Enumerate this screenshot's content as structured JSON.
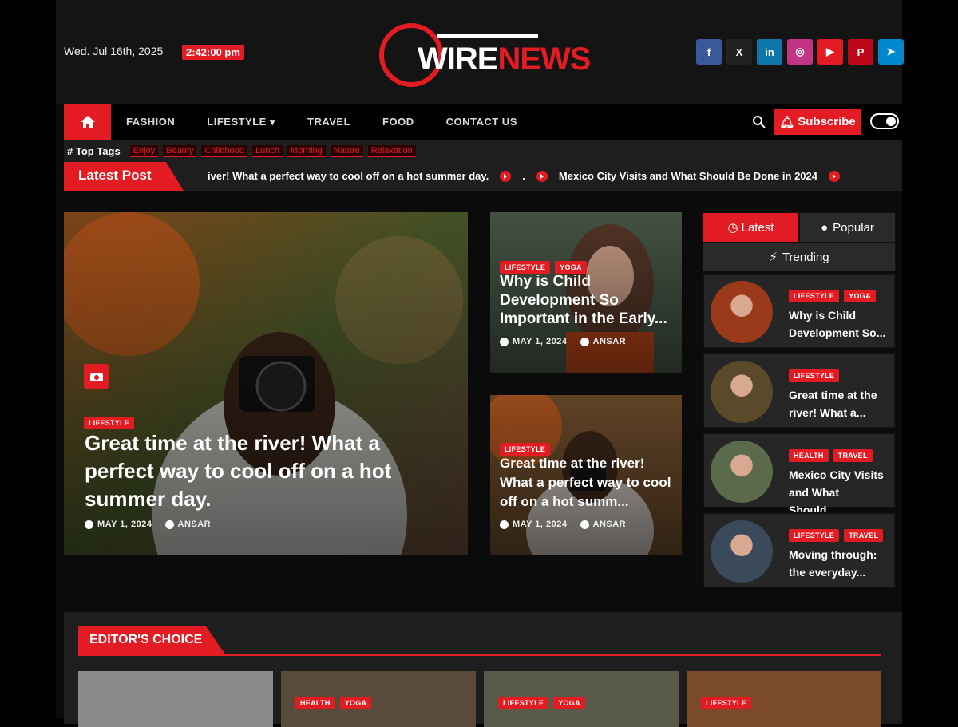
{
  "header": {
    "date": "Wed. Jul 16th, 2025",
    "time": "2:42:00 pm",
    "logo_part1": "WIRE",
    "logo_part2": "NEWS",
    "social": [
      {
        "name": "facebook",
        "glyph": "f",
        "color": "#3b5998"
      },
      {
        "name": "x",
        "glyph": "X",
        "color": "#222222"
      },
      {
        "name": "linkedin",
        "glyph": "in",
        "color": "#0e76a8"
      },
      {
        "name": "instagram",
        "glyph": "◎",
        "color": "#c13584"
      },
      {
        "name": "youtube",
        "glyph": "▶",
        "color": "#e31b23"
      },
      {
        "name": "pinterest",
        "glyph": "P",
        "color": "#bd081c"
      },
      {
        "name": "telegram",
        "glyph": "➤",
        "color": "#0088cc"
      }
    ]
  },
  "nav": {
    "items": [
      "FASHION",
      "LIFESTYLE ▾",
      "TRAVEL",
      "FOOD",
      "CONTACT US"
    ],
    "subscribe_label": "Subscribe"
  },
  "tags": {
    "label": "# Top Tags",
    "items": [
      "Enjoy",
      "Beauty",
      "Childhood",
      "Lunch",
      "Morning",
      "Nature",
      "Relaxation"
    ]
  },
  "ticker": {
    "label": "Latest Post",
    "items": [
      "iver! What a perfect way to cool off on a hot summer day.",
      ".",
      "Mexico City Visits and What Should Be Done in 2024"
    ]
  },
  "featured": {
    "category": "LIFESTYLE",
    "title": "Great time at the river! What a perfect way to cool off on a hot summer day.",
    "date": "MAY 1, 2024",
    "author": "ANSAR"
  },
  "small_cards": [
    {
      "categories": [
        "LIFESTYLE",
        "YOGA"
      ],
      "title": "Why is Child Development So Important in the Early...",
      "date": "MAY 1, 2024",
      "author": "ANSAR"
    },
    {
      "categories": [
        "LIFESTYLE"
      ],
      "title": "Great time at the river! What a perfect way to cool off on a hot summ...",
      "date": "MAY 1, 2024",
      "author": "ANSAR"
    }
  ],
  "sidebar": {
    "tabs": [
      "Latest",
      "Popular",
      "Trending"
    ],
    "items": [
      {
        "categories": [
          "LIFESTYLE",
          "YOGA"
        ],
        "title": "Why is Child Development So..."
      },
      {
        "categories": [
          "LIFESTYLE"
        ],
        "title": "Great time at the river! What a..."
      },
      {
        "categories": [
          "HEALTH",
          "TRAVEL"
        ],
        "title": "Mexico City Visits and What Should..."
      },
      {
        "categories": [
          "LIFESTYLE",
          "TRAVEL"
        ],
        "title": "Moving through: the everyday..."
      }
    ]
  },
  "editors_choice": {
    "label": "EDITOR'S CHOICE",
    "cards": [
      {
        "categories": []
      },
      {
        "categories": [
          "HEALTH",
          "YOGA"
        ]
      },
      {
        "categories": [
          "LIFESTYLE",
          "YOGA"
        ]
      },
      {
        "categories": [
          "LIFESTYLE"
        ]
      }
    ]
  }
}
